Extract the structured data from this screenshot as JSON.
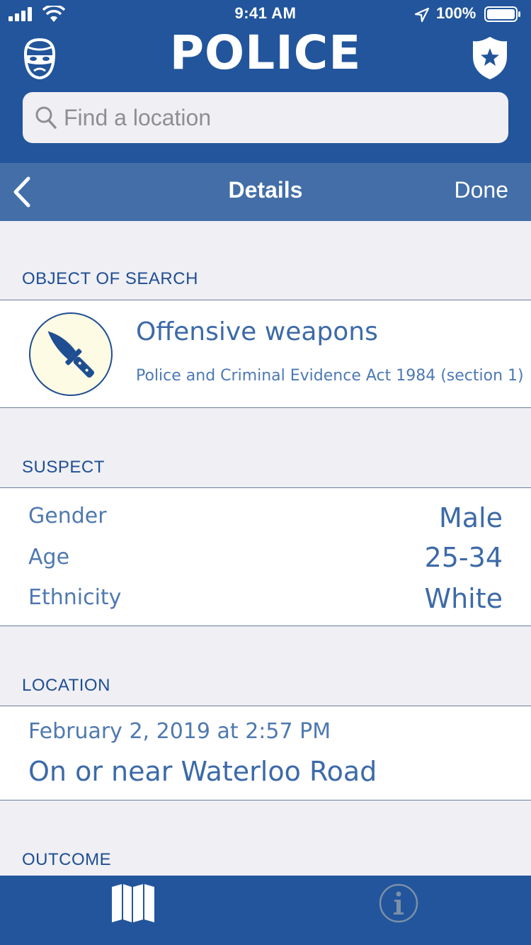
{
  "status": {
    "time": "9:41 AM",
    "battery": "100%"
  },
  "app": {
    "title": "POLICE"
  },
  "search": {
    "placeholder": "Find a location"
  },
  "nav": {
    "title": "Details",
    "done": "Done"
  },
  "object_of_search": {
    "header": "OBJECT OF SEARCH",
    "title": "Offensive weapons",
    "legislation": "Police and Criminal Evidence Act 1984 (section 1)"
  },
  "suspect": {
    "header": "SUSPECT",
    "rows": [
      {
        "label": "Gender",
        "value": "Male"
      },
      {
        "label": "Age",
        "value": "25-34"
      },
      {
        "label": "Ethnicity",
        "value": "White"
      }
    ]
  },
  "location": {
    "header": "LOCATION",
    "datetime": "February 2, 2019 at 2:57 PM",
    "place": "On or near Waterloo Road"
  },
  "outcome": {
    "header": "OUTCOME"
  },
  "icons": {
    "header_left": "thief-mask-icon",
    "header_right": "police-badge-icon",
    "search": "search-icon",
    "back": "chevron-left-icon",
    "object": "knife-icon",
    "tab_map": "map-icon",
    "tab_info": "info-icon"
  },
  "colors": {
    "brand": "#22559b",
    "navbar": "#436ea8",
    "text_primary": "#3d6aa8",
    "icon_bg": "#fdfbe3"
  }
}
